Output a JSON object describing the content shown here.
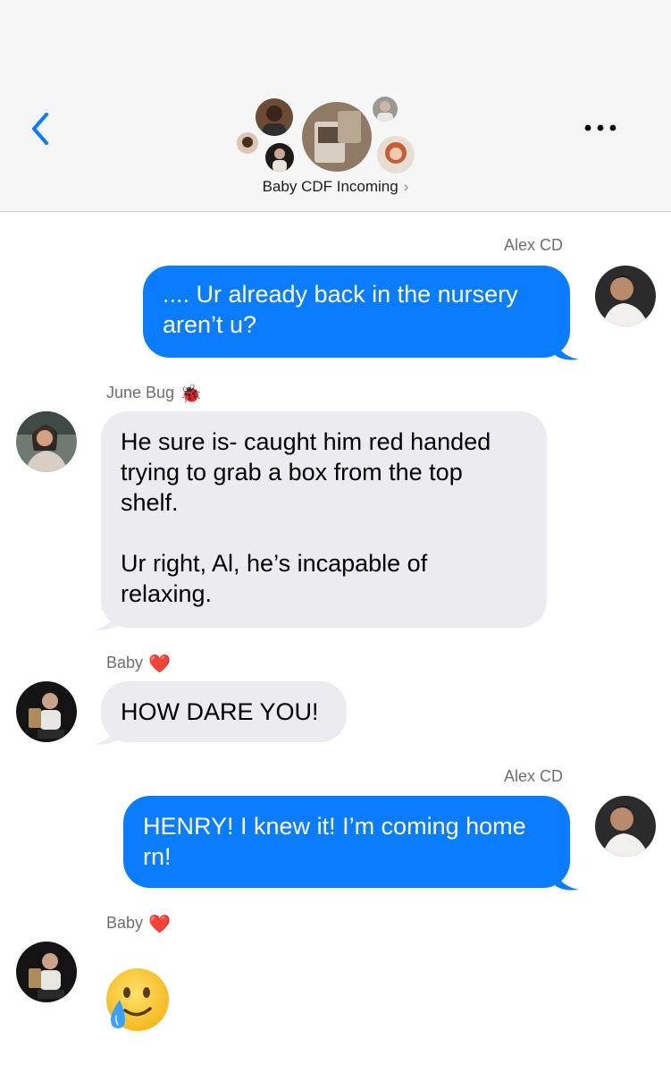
{
  "header": {
    "group_name": "Baby CDF Incoming",
    "chevron": "›",
    "back_icon": "chevron-left-icon",
    "more_icon": "ellipsis-icon",
    "accent_color": "#0a7cff"
  },
  "messages": [
    {
      "sender": "Alex CD",
      "direction": "outgoing",
      "text": ".... Ur already back in the nursery\naren’t u?"
    },
    {
      "sender": "June Bug",
      "sender_emoji": "🐞",
      "direction": "incoming",
      "text": "He sure is- caught him red handed\ntrying to grab a box from the top\nshelf.\n\nUr right, Al, he’s incapable of\nrelaxing."
    },
    {
      "sender": "Baby",
      "sender_emoji": "❤️",
      "direction": "incoming",
      "text": "HOW DARE YOU!"
    },
    {
      "sender": "Alex CD",
      "direction": "outgoing",
      "text": "HENRY! I knew it! I’m coming home\nrn!"
    },
    {
      "sender": "Baby",
      "sender_emoji": "❤️",
      "direction": "incoming",
      "emoji_reply": "smiling-face-with-tear"
    }
  ],
  "colors": {
    "outgoing_bubble": "#0a7cff",
    "incoming_bubble": "#ebebf0",
    "sender_label": "#6e6e73"
  }
}
